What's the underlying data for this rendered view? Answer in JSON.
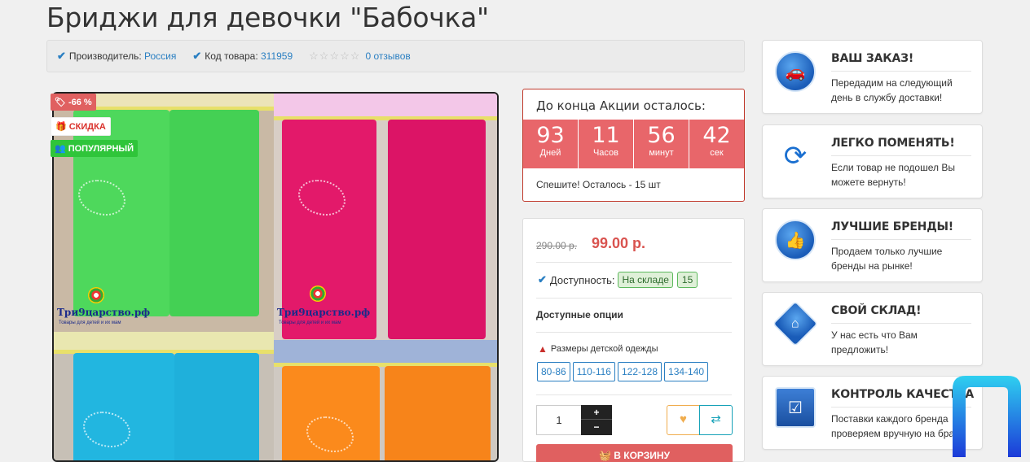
{
  "title": "Бриджи для девочки \"Бабочка\"",
  "info": {
    "manufacturer_label": "Производитель:",
    "manufacturer_value": "Россия",
    "code_label": "Код товара:",
    "code_value": "311959",
    "reviews": "0 отзывов"
  },
  "badges": {
    "discount": "-66 %",
    "sale": "СКИДКА",
    "popular": "ПОПУЛЯРНЫЙ"
  },
  "watermark": {
    "name": "Три9царство.рф",
    "tagline": "Товары для детей и их мам"
  },
  "countdown": {
    "title": "До конца Акции осталось:",
    "cells": [
      {
        "value": "93",
        "label": "Дней"
      },
      {
        "value": "11",
        "label": "Часов"
      },
      {
        "value": "56",
        "label": "минут"
      },
      {
        "value": "42",
        "label": "сек"
      }
    ],
    "note": "Спешите! Осталось - 15 шт"
  },
  "purchase": {
    "old_price": "290.00 р.",
    "price": "99.00 р.",
    "availability_label": "Доступность:",
    "stock_status": "На складе",
    "stock_qty": "15",
    "options_title": "Доступные опции",
    "size_label": "Размеры детской одежды",
    "sizes": [
      "80-86",
      "110-116",
      "122-128",
      "134-140"
    ],
    "quantity": "1",
    "plus": "+",
    "minus": "−",
    "cart_label": "В КОРЗИНУ"
  },
  "features": [
    {
      "icon": "car-icon",
      "title": "ВАШ ЗАКАЗ!",
      "text": "Передадим на следующий день в службу доставки!"
    },
    {
      "icon": "refresh-icon",
      "title": "ЛЕГКО ПОМЕНЯТЬ!",
      "text": "Если товар не подошел Вы можете вернуть!"
    },
    {
      "icon": "thumbs-up-icon",
      "title": "ЛУЧШИЕ БРЕНДЫ!",
      "text": "Продаем только лучшие бренды на рынке!"
    },
    {
      "icon": "warehouse-icon",
      "title": "СВОЙ СКЛАД!",
      "text": "У нас есть что Вам предложить!"
    },
    {
      "icon": "quality-check-icon",
      "title": "КОНТРОЛЬ КАЧЕСТВА",
      "text": "Поставки каждого бренда проверяем вручную на брак!"
    }
  ],
  "colors": {
    "accent_blue": "#2a7fc2",
    "accent_red": "#e06060",
    "stock_green": "#5cb85c"
  }
}
